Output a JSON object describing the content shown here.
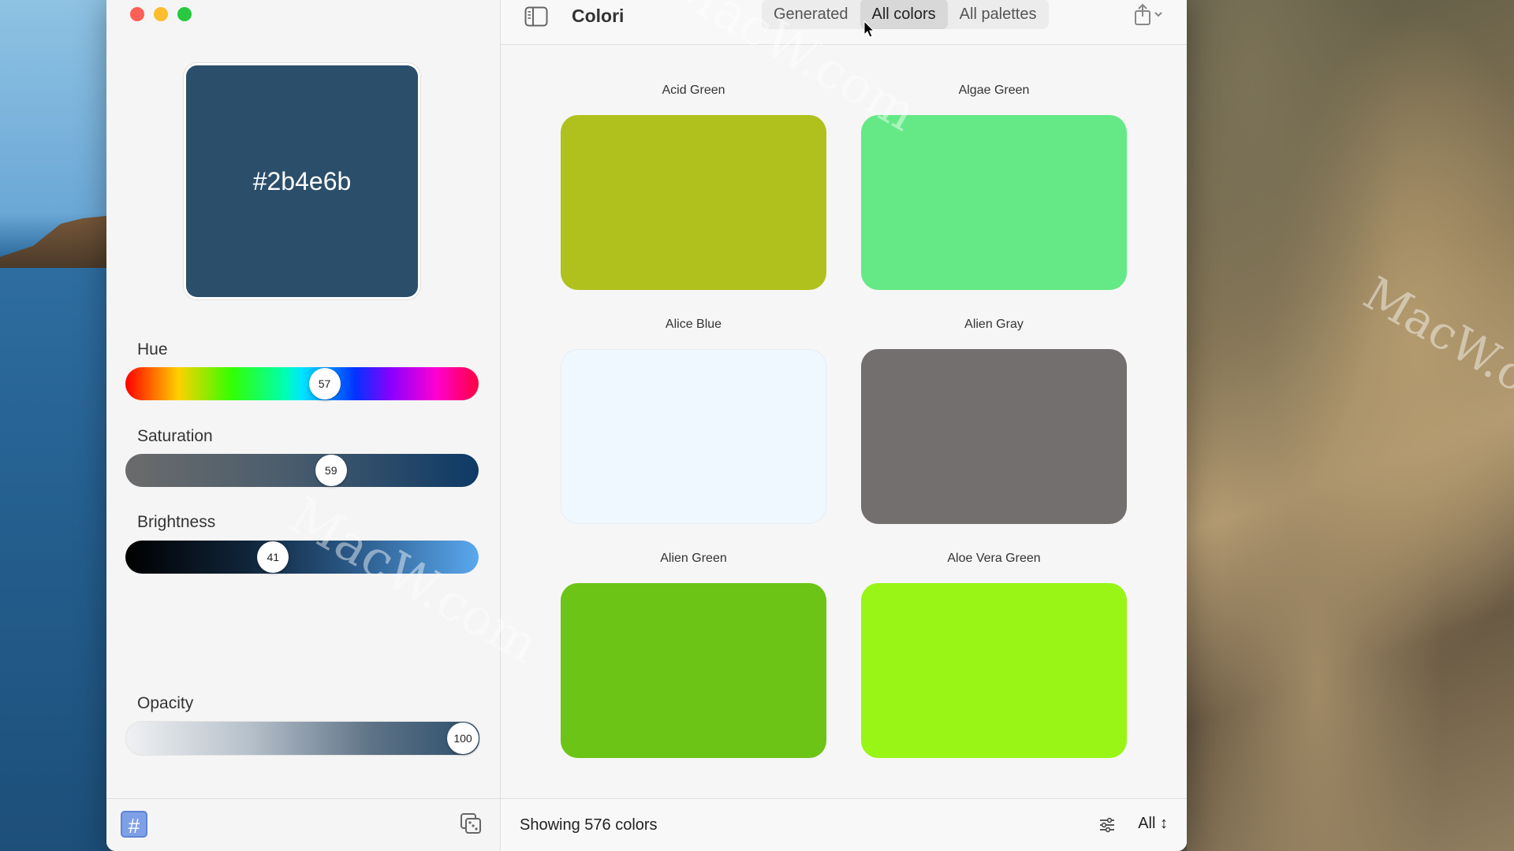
{
  "window": {
    "title": "Colori"
  },
  "toolbar": {
    "tabs": [
      {
        "label": "Generated",
        "active": false
      },
      {
        "label": "All colors",
        "active": true
      },
      {
        "label": "All palettes",
        "active": false
      }
    ]
  },
  "editor": {
    "current_hex": "#2b4e6b",
    "current_color": "#2b4e6b",
    "sliders": {
      "hue": {
        "label": "Hue",
        "value": "57",
        "fraction": 0.57
      },
      "saturation": {
        "label": "Saturation",
        "value": "59",
        "fraction": 0.59
      },
      "brightness": {
        "label": "Brightness",
        "value": "41",
        "fraction": 0.41
      },
      "opacity": {
        "label": "Opacity",
        "value": "100",
        "fraction": 1.0
      }
    },
    "hash_button": "#"
  },
  "colors": [
    {
      "name": "Acid Green",
      "hex": "#b0c11d"
    },
    {
      "name": "Algae Green",
      "hex": "#64e986"
    },
    {
      "name": "Alice Blue",
      "hex": "#f0f8ff"
    },
    {
      "name": "Alien Gray",
      "hex": "#736f6e"
    },
    {
      "name": "Alien Green",
      "hex": "#6cc417"
    },
    {
      "name": "Aloe Vera Green",
      "hex": "#98f516"
    }
  ],
  "footer": {
    "count_text": "Showing 576 colors",
    "filter_value": "All"
  },
  "watermarks": [
    "MacW.com",
    "MacW.com",
    "MacW.c"
  ]
}
